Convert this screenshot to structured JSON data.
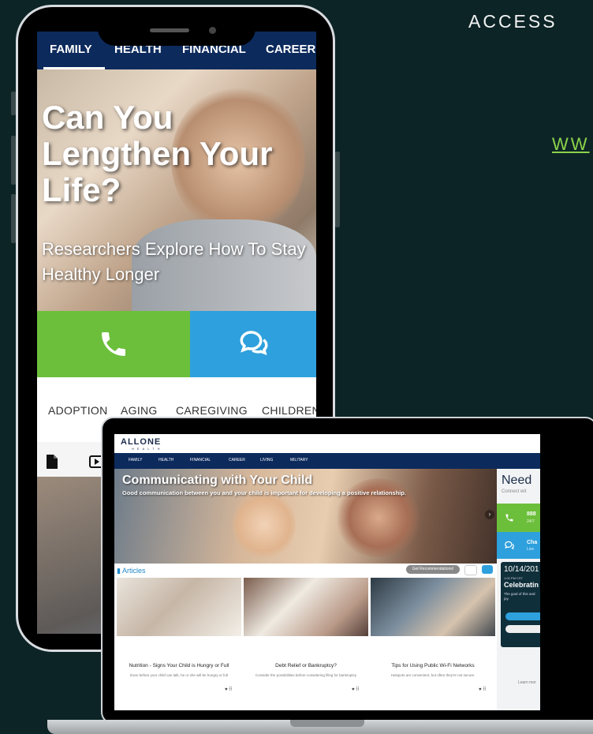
{
  "page": {
    "heading": "ACCESS",
    "link_text": "WW"
  },
  "phone": {
    "tabs": [
      "FAMILY",
      "HEALTH",
      "FINANCIAL",
      "CAREER"
    ],
    "hero": {
      "title": "Can You Lengthen Your Life?",
      "subtitle": "Researchers Explore How To Stay Healthy Longer"
    },
    "categories": [
      "ADOPTION",
      "AGING",
      "CAREGIVING",
      "CHILDREN"
    ],
    "colors": {
      "nav": "#0c2a5c",
      "call": "#6cbf3b",
      "chat": "#2ea0dd"
    }
  },
  "laptop": {
    "logo": "ALLONE",
    "logo_sub": "HEALTH",
    "nav": [
      "FAMILY",
      "HEALTH",
      "FINANCIAL",
      "CAREER",
      "LIVING",
      "MILITARY"
    ],
    "hero": {
      "title": "Communicating with Your Child",
      "subtitle": "Good communication between you and your child is important for developing a positive relationship."
    },
    "sidebar": {
      "need": "Need",
      "connect": "Connect wit",
      "call_number": "888",
      "call_hours": "24/7",
      "chat_label": "Cha",
      "chat_status": "Live",
      "event_date": "10/14/201",
      "event_time": "1:00 PM CST",
      "event_title": "Celebratin",
      "event_desc": "The goal of this and joy.",
      "learn_more": "Learn mor"
    },
    "articles_label": "Articles",
    "get_recommendations": "Get Recommendations!",
    "cards": [
      {
        "title": "Nutrition - Signs Your Child is Hungry or Full",
        "desc": "Even before your child can talk, he or she will be hungry or full"
      },
      {
        "title": "Debt Relief or Bankruptcy?",
        "desc": "Consider the possibilities before considering filing for bankruptcy"
      },
      {
        "title": "Tips for Using Public Wi-Fi Networks",
        "desc": "Hotspots are convenient, but often they're not secure."
      }
    ]
  }
}
